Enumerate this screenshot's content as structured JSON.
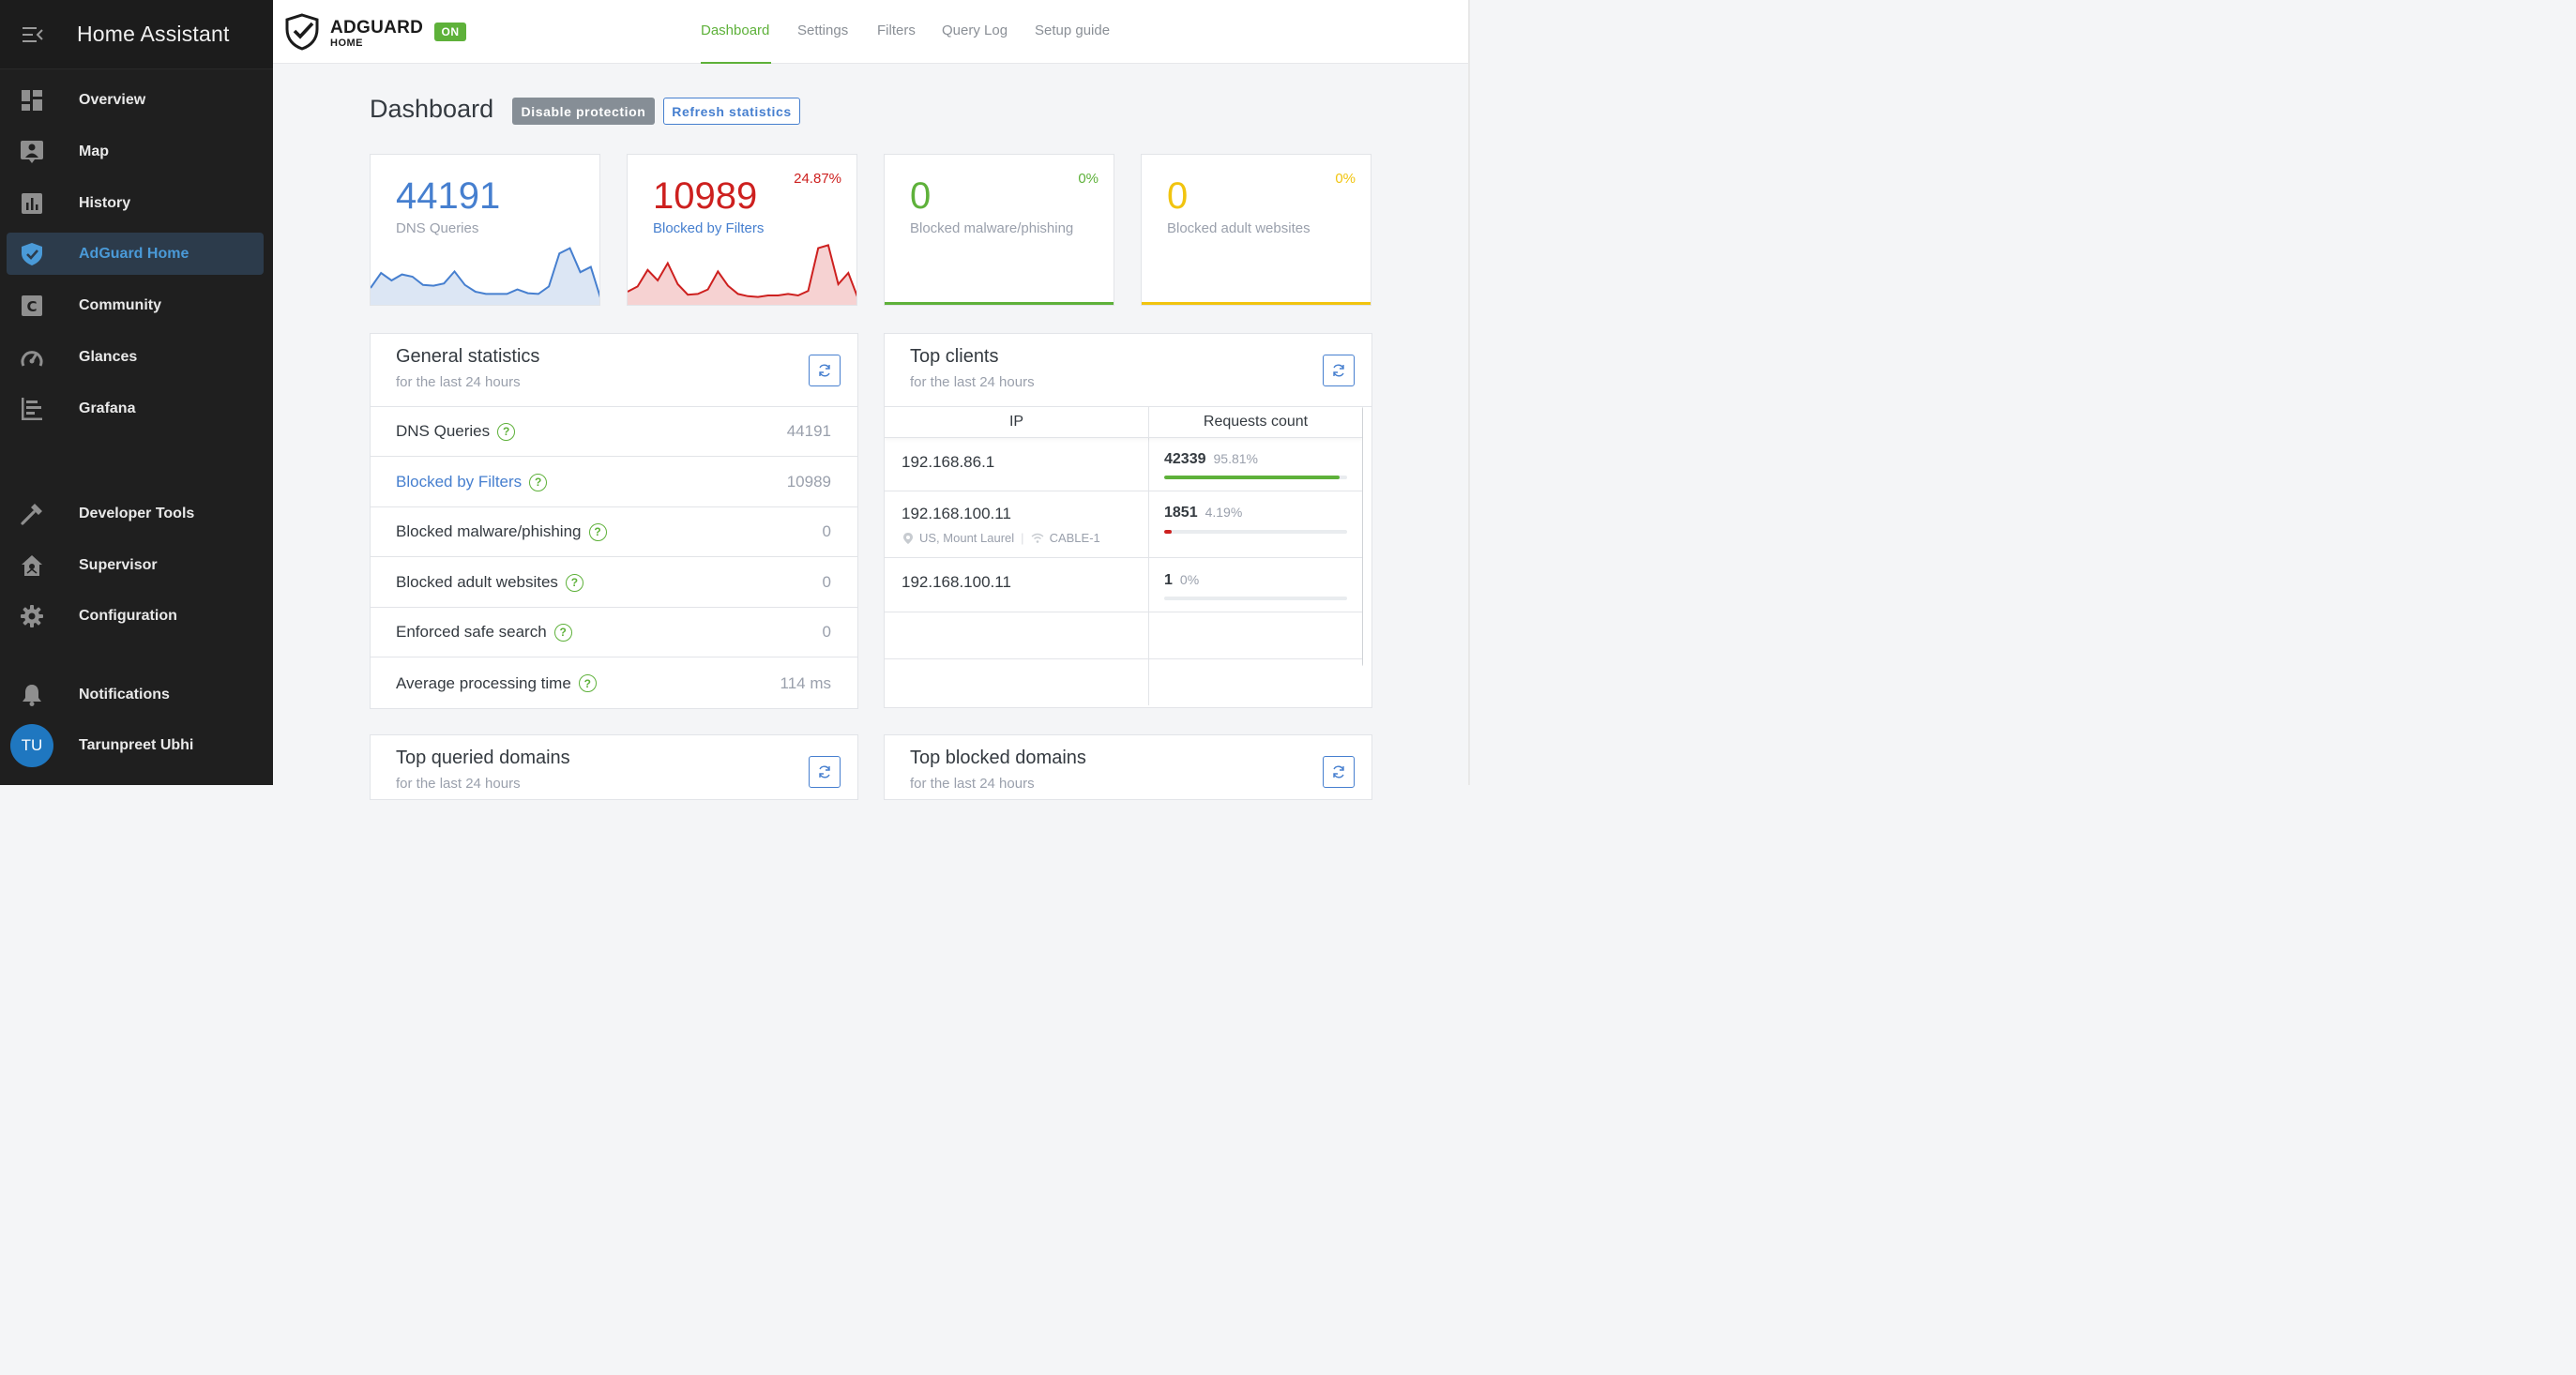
{
  "sidebar": {
    "title": "Home Assistant",
    "items": [
      {
        "label": "Overview",
        "icon": "dashboard-icon"
      },
      {
        "label": "Map",
        "icon": "map-icon"
      },
      {
        "label": "History",
        "icon": "history-icon"
      },
      {
        "label": "AdGuard Home",
        "icon": "shield-check-icon",
        "active": true
      },
      {
        "label": "Community",
        "icon": "community-icon"
      },
      {
        "label": "Glances",
        "icon": "gauge-icon"
      },
      {
        "label": "Grafana",
        "icon": "grafana-icon"
      },
      {
        "label": "Developer Tools",
        "icon": "hammer-icon"
      },
      {
        "label": "Supervisor",
        "icon": "supervisor-icon"
      },
      {
        "label": "Configuration",
        "icon": "gear-icon"
      },
      {
        "label": "Notifications",
        "icon": "bell-icon"
      }
    ],
    "user": {
      "initials": "TU",
      "name": "Tarunpreet Ubhi"
    }
  },
  "topbar": {
    "logo_main": "ADGUARD",
    "logo_sub": "HOME",
    "status_badge": "ON",
    "nav": [
      "Dashboard",
      "Settings",
      "Filters",
      "Query Log",
      "Setup guide"
    ],
    "active_nav": "Dashboard"
  },
  "page": {
    "title": "Dashboard",
    "disable_button": "Disable protection",
    "refresh_button": "Refresh statistics"
  },
  "stat_cards": [
    {
      "value": "44191",
      "label": "DNS Queries",
      "percent": "",
      "color": "#467fcf"
    },
    {
      "value": "10989",
      "label": "Blocked by Filters",
      "percent": "24.87%",
      "color": "#cd201f"
    },
    {
      "value": "0",
      "label": "Blocked malware/phishing",
      "percent": "0%",
      "color": "#5eb13a"
    },
    {
      "value": "0",
      "label": "Blocked adult websites",
      "percent": "0%",
      "color": "#f1c40f"
    }
  ],
  "chart_data": [
    {
      "type": "area",
      "series": [
        {
          "values": [
            2,
            4,
            3,
            3.8,
            3.5,
            2.4,
            2.3,
            2.6,
            4.2,
            2.4,
            1.5,
            1.2,
            1.2,
            1.2,
            1.8,
            1.3,
            1.2,
            2.2,
            6.6,
            7.3,
            4.1,
            4.8,
            0.3
          ]
        }
      ]
    },
    {
      "type": "area",
      "series": [
        {
          "values": [
            1.5,
            2.2,
            4.4,
            3,
            5.3,
            2.5,
            1.1,
            1.2,
            1.8,
            4.2,
            2.3,
            1.2,
            0.9,
            0.8,
            1,
            1,
            1.2,
            1,
            1.6,
            7.3,
            7.7,
            2.5,
            4,
            0.5
          ]
        }
      ]
    }
  ],
  "general_stats": {
    "title": "General statistics",
    "subtitle": "for the last 24 hours",
    "rows": [
      {
        "label": "DNS Queries",
        "value": "44191",
        "link": false
      },
      {
        "label": "Blocked by Filters",
        "value": "10989",
        "link": true
      },
      {
        "label": "Blocked malware/phishing",
        "value": "0",
        "link": false
      },
      {
        "label": "Blocked adult websites",
        "value": "0",
        "link": false
      },
      {
        "label": "Enforced safe search",
        "value": "0",
        "link": false
      },
      {
        "label": "Average processing time",
        "value": "114 ms",
        "link": false
      }
    ]
  },
  "top_clients": {
    "title": "Top clients",
    "subtitle": "for the last 24 hours",
    "col_ip": "IP",
    "col_requests": "Requests count",
    "rows": [
      {
        "ip": "192.168.86.1",
        "location": "",
        "network": "",
        "count": "42339",
        "percent": "95.81%",
        "fraction": 0.958,
        "color": "#5eb13a"
      },
      {
        "ip": "192.168.100.11",
        "location": "US, Mount Laurel",
        "network": "CABLE-1",
        "count": "1851",
        "percent": "4.19%",
        "fraction": 0.042,
        "color": "#cd201f"
      },
      {
        "ip": "192.168.100.11",
        "location": "",
        "network": "",
        "count": "1",
        "percent": "0%",
        "fraction": 0,
        "color": "#5eb13a"
      }
    ]
  },
  "bottom_cards": [
    {
      "title": "Top queried domains",
      "subtitle": "for the last 24 hours"
    },
    {
      "title": "Top blocked domains",
      "subtitle": "for the last 24 hours"
    }
  ]
}
